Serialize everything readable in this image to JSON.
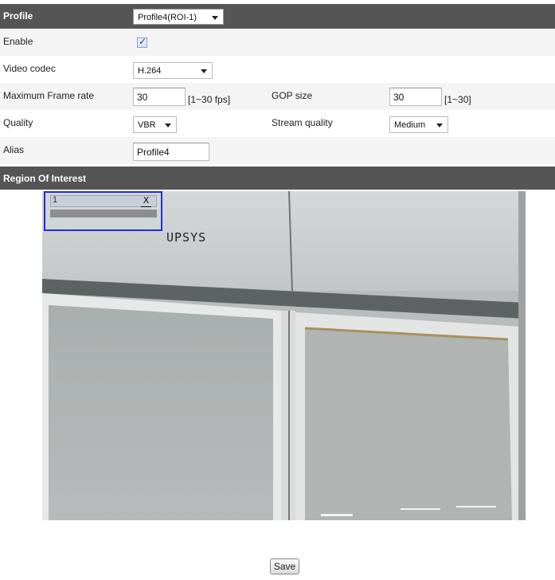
{
  "profile": {
    "label": "Profile",
    "value": "Profile4(ROI-1)"
  },
  "enable": {
    "label": "Enable",
    "checked": true
  },
  "video_codec": {
    "label": "Video codec",
    "value": "H.264"
  },
  "frame_rate": {
    "label": "Maximum Frame rate",
    "value": "30",
    "range": "[1~30 fps]"
  },
  "gop": {
    "label": "GOP size",
    "value": "30",
    "range": "[1~30]"
  },
  "quality": {
    "label": "Quality",
    "value": "VBR"
  },
  "stream_quality": {
    "label": "Stream quality",
    "value": "Medium"
  },
  "alias": {
    "label": "Alias",
    "value": "Profile4"
  },
  "roi_section": {
    "label": "Region Of Interest"
  },
  "roi_box": {
    "number": "1",
    "close": "X"
  },
  "camera_overlay": {
    "text": "UPSYS"
  },
  "save_label": "Save"
}
